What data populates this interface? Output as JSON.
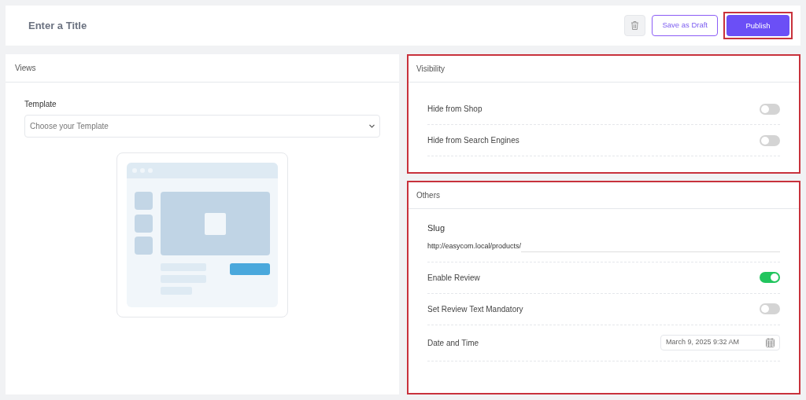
{
  "header": {
    "title": "Enter a Title",
    "buttons": [
      {
        "kind": "delete"
      },
      {
        "kind": "outline",
        "label": "Save as Draft"
      },
      {
        "kind": "primary",
        "label": "Publish",
        "highlighted": true
      }
    ]
  },
  "views": {
    "title": "Views",
    "template_label": "Template",
    "template_placeholder": "Choose your Template"
  },
  "visibility": {
    "title": "Visibility",
    "highlighted": true,
    "rows": [
      {
        "kind": "toggle",
        "label": "Hide from Shop",
        "on": false
      },
      {
        "kind": "toggle",
        "label": "Hide from Search Engines",
        "on": false
      }
    ]
  },
  "others": {
    "title": "Others",
    "highlighted": true,
    "rows": [
      {
        "kind": "slug",
        "label": "Slug",
        "prefix": "http://easycom.local/products/"
      },
      {
        "kind": "toggle",
        "label": "Enable Review",
        "on": true
      },
      {
        "kind": "toggle",
        "label": "Set Review Text Mandatory",
        "on": false
      },
      {
        "kind": "date",
        "label": "Date and Time",
        "value": "March 9, 2025 9:32 AM"
      }
    ]
  }
}
